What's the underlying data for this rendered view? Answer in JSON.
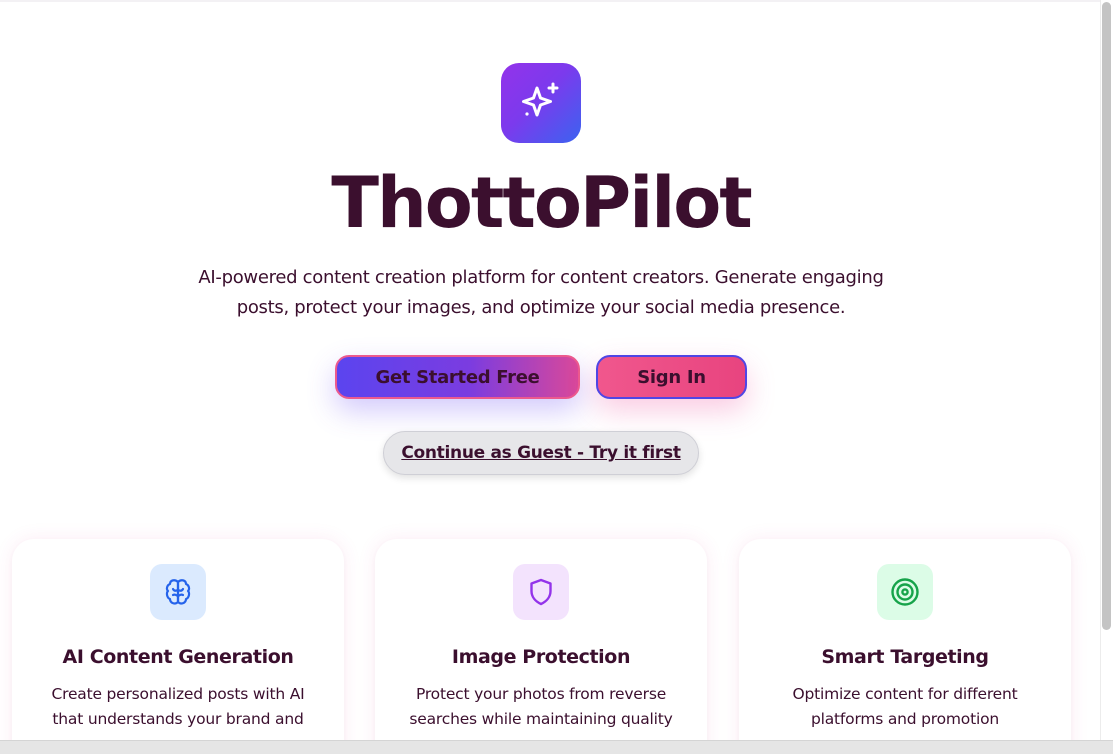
{
  "app": {
    "logo_icon": "sparkles-icon",
    "title": "ThottoPilot",
    "subtitle_line1": "AI-powered content creation platform for content creators. Generate engaging",
    "subtitle_line2": "posts, protect your images, and optimize your social media presence."
  },
  "actions": {
    "get_started_label": "Get Started Free",
    "sign_in_label": "Sign In",
    "guest_label": "Continue as Guest - Try it first"
  },
  "features": [
    {
      "icon": "brain-icon",
      "icon_color": "#2563eb",
      "title": "AI Content Generation",
      "desc_line1": "Create personalized posts with AI",
      "desc_line2": "that understands your brand and"
    },
    {
      "icon": "shield-icon",
      "icon_color": "#9333ea",
      "title": "Image Protection",
      "desc_line1": "Protect your photos from reverse",
      "desc_line2": "searches while maintaining quality"
    },
    {
      "icon": "target-icon",
      "icon_color": "#16a34a",
      "title": "Smart Targeting",
      "desc_line1": "Optimize content for different",
      "desc_line2": "platforms and promotion"
    }
  ],
  "colors": {
    "text": "#3b0f2e",
    "brand_purple": "#7c3aed",
    "brand_blue": "#3b63f0",
    "brand_pink": "#ec4899"
  }
}
